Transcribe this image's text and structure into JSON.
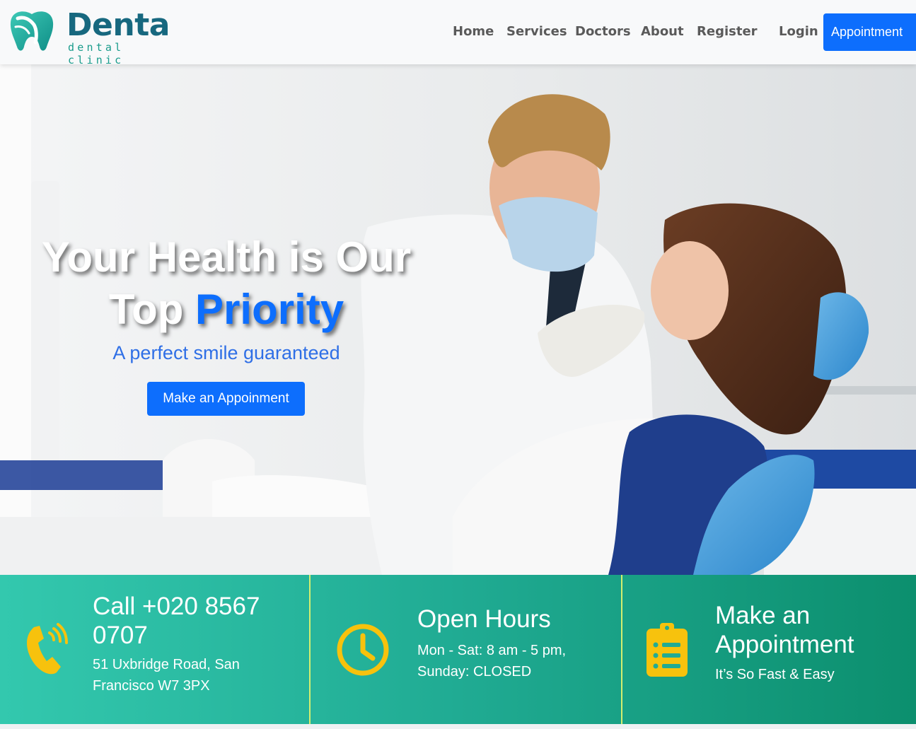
{
  "brand": {
    "name": "Denta",
    "tagline": "dental clinic",
    "colors": {
      "primary": "#17687f",
      "accent": "#1a9c8c"
    }
  },
  "nav": {
    "items": [
      {
        "label": "Home"
      },
      {
        "label": "Services"
      },
      {
        "label": "Doctors"
      },
      {
        "label": "About"
      },
      {
        "label": "Register"
      },
      {
        "label": "Login"
      }
    ],
    "cta_label": "Appointment"
  },
  "hero": {
    "title_line1": "Your Health is Our",
    "title_line2_plain": "Top",
    "title_line2_accent": "Priority",
    "subtitle": "A perfect smile guaranteed",
    "button_label": "Make an Appoinment",
    "image": "dentist-examining-patient-photo"
  },
  "info": {
    "call": {
      "icon": "phone-icon",
      "title": "Call +020 8567 0707",
      "text": "51 Uxbridge Road, San Francisco W7 3PX"
    },
    "hours": {
      "icon": "clock-icon",
      "title": "Open Hours",
      "text": "Mon - Sat: 8 am - 5 pm, Sunday: CLOSED"
    },
    "appointment": {
      "icon": "clipboard-list-icon",
      "title": "Make an Appointment",
      "text": "It’s So Fast & Easy"
    }
  },
  "colors": {
    "button_blue": "#0d6efd",
    "icon_yellow": "#f7c20d",
    "divider_lime": "#d4ef6f",
    "strip_start": "#33c8ae",
    "strip_end": "#0c8f6e"
  }
}
